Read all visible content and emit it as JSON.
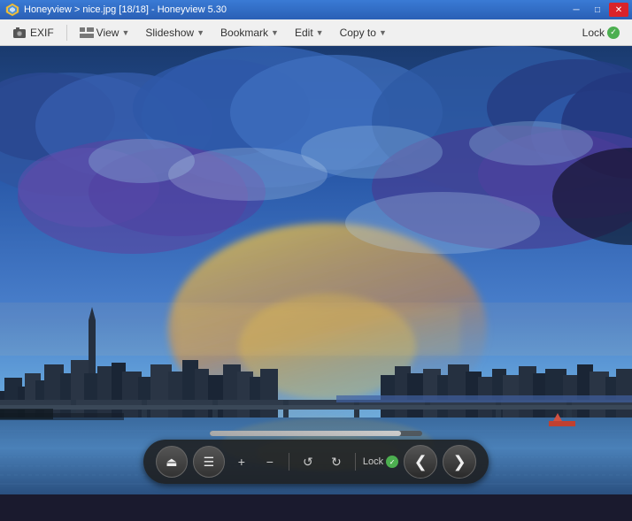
{
  "window": {
    "title": "Honeyview > nice.jpg [18/18] - Honeyview 5.30",
    "app_name": "Honeyview 5.30"
  },
  "title_controls": {
    "minimize": "─",
    "restore": "□",
    "close": "✕"
  },
  "menu": {
    "exif_label": "EXIF",
    "view_label": "View",
    "slideshow_label": "Slideshow",
    "bookmark_label": "Bookmark",
    "edit_label": "Edit",
    "copyto_label": "Copy to",
    "lock_label": "Lock"
  },
  "controls": {
    "eject": "⏏",
    "menu_icon": "☰",
    "zoom_in": "+",
    "zoom_out": "−",
    "rotate_ccw": "↺",
    "rotate_cw": "↻",
    "lock_label": "Lock",
    "prev": "❮",
    "next": "❯"
  },
  "progress": {
    "value": 90
  }
}
